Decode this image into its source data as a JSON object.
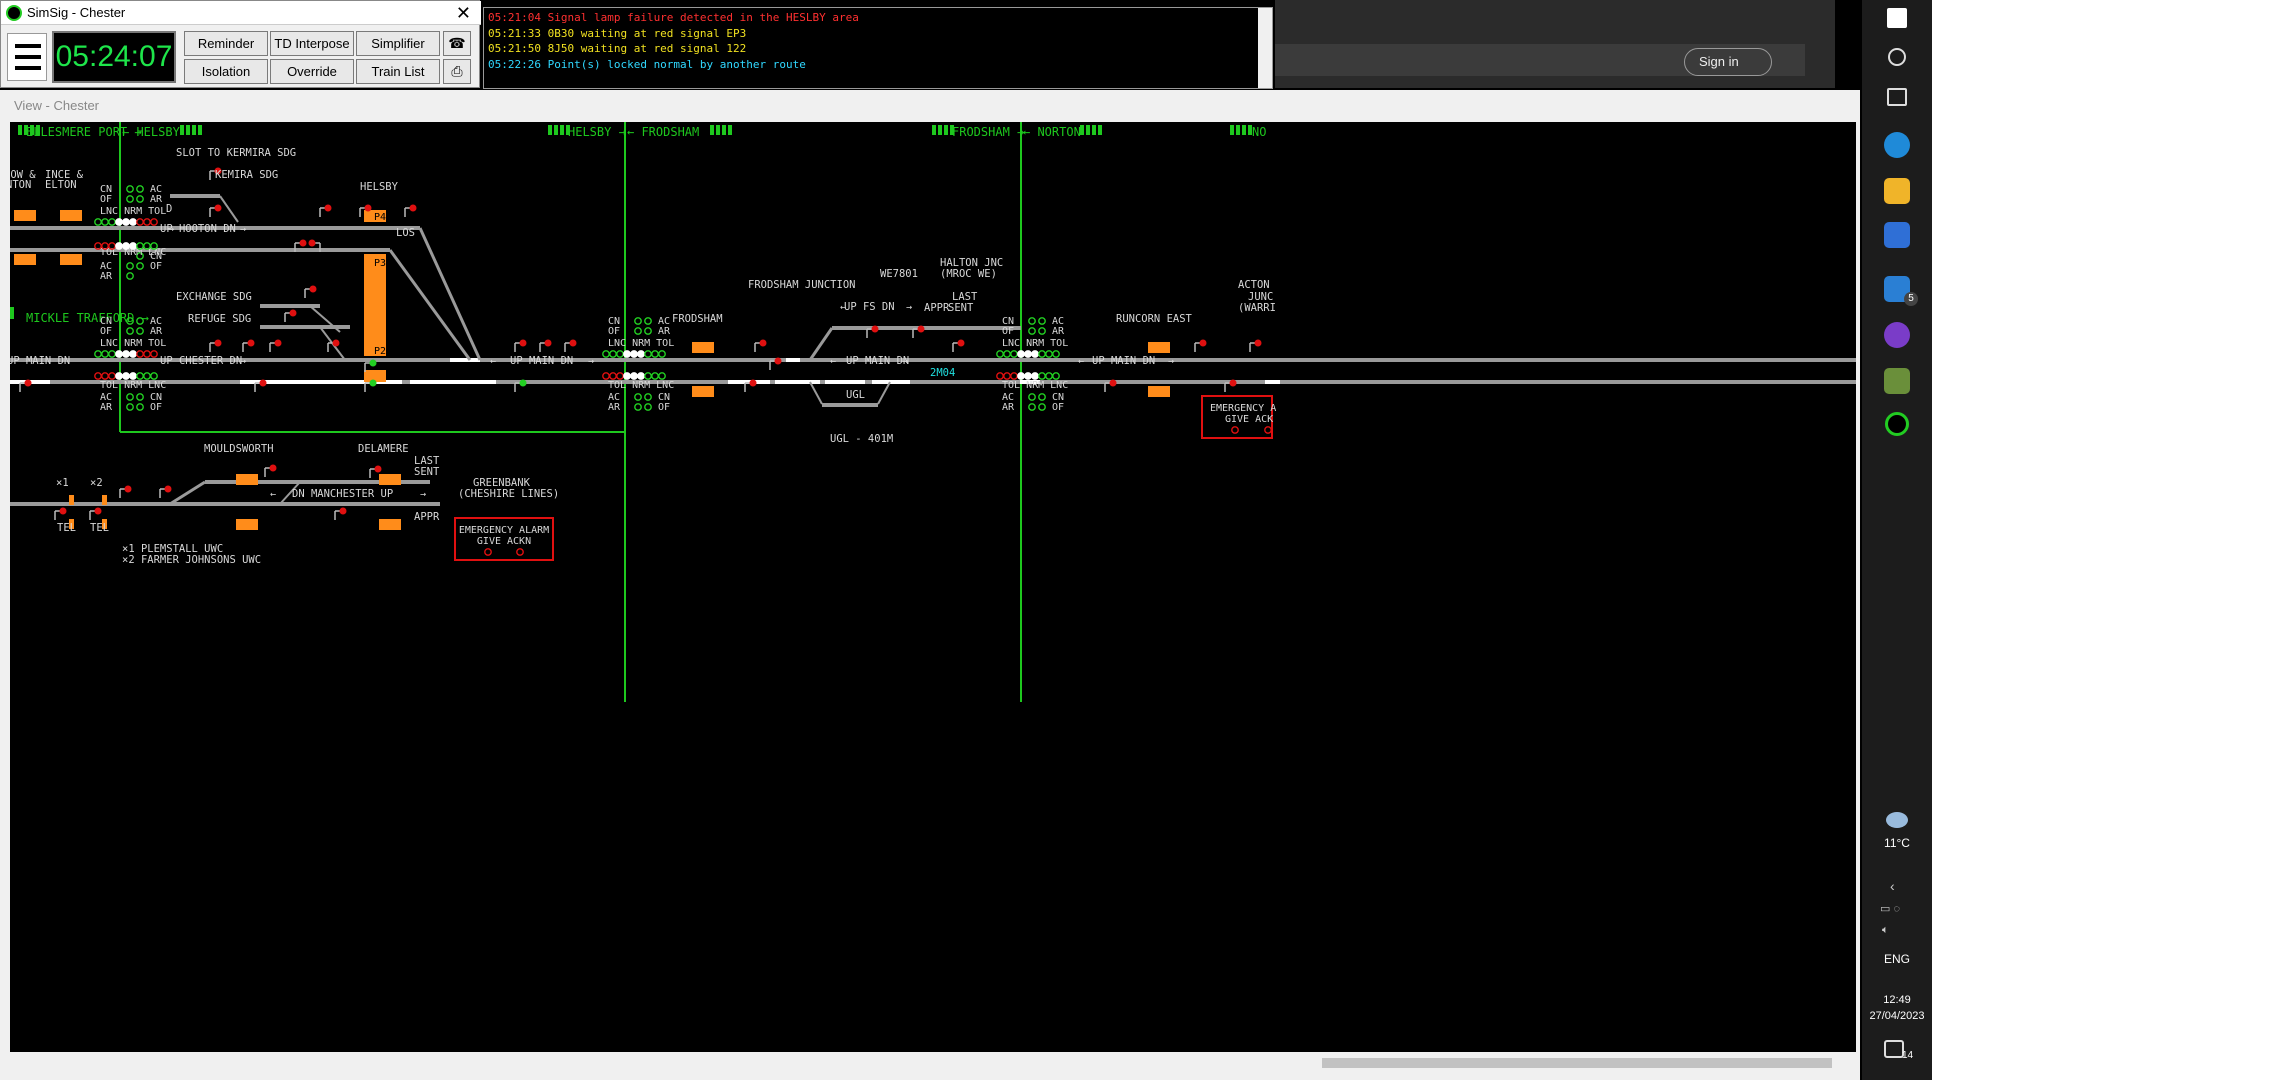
{
  "control": {
    "title": "SimSig - Chester",
    "clock": "05:24:07",
    "buttons": [
      "Reminder",
      "TD Interpose",
      "Simplifier",
      "Isolation",
      "Override",
      "Train List"
    ]
  },
  "messages": [
    {
      "text": "05:21:04 Signal lamp failure detected in the HESLBY area",
      "color": "#ff3030"
    },
    {
      "text": "05:21:33 0B30 waiting at red signal EP3",
      "color": "#f0e020"
    },
    {
      "text": "05:21:50 8J50 waiting at red signal 122",
      "color": "#f0e020"
    },
    {
      "text": "05:22:26 Point(s) locked normal by another route",
      "color": "#30d8ff"
    }
  ],
  "browser": {
    "signin": "Sign in"
  },
  "view": {
    "title": "View - Chester"
  },
  "colors": {
    "track": "#9a9a9a",
    "route": "#ffffff",
    "area": "#1ec81e",
    "label": "#d8d8d8",
    "platform": "#ff8c1a",
    "alarm": "#e01010",
    "berth": "#20e0e0"
  },
  "diagram": {
    "area_headers": [
      {
        "text": "ELLESMERE PORT →"
      },
      {
        "text": "← HELSBY"
      },
      {
        "text": "HELSBY →"
      },
      {
        "text": "← FRODSHAM"
      },
      {
        "text": "FRODSHAM →"
      },
      {
        "text": "← NORTON"
      },
      {
        "text": "NO"
      },
      {
        "text": "MICKLE TRAFFORD →"
      }
    ],
    "labels": {
      "slot": "SLOT TO KERMIRA SDG",
      "kemira": "KEMIRA SDG",
      "helsby": "HELSBY",
      "low_a": "LOW &",
      "nton": "NTON",
      "ince_a": "INCE &",
      "elton": "ELTON",
      "up_hooton": "UP HOOTON DN",
      "exchange": "EXCHANGE SDG",
      "refuge": "REFUGE SDG",
      "up_chester": "UP CHESTER DN",
      "up_main_dn_1": "UP MAIN DN",
      "up_main_dn_2": "UP MAIN DN",
      "up_main_dn_3": "UP MAIN DN",
      "up_main_dn_4": "UP MAIN DN",
      "frodsham": "FRODSHAM",
      "frod_jn": "FRODSHAM JUNCTION",
      "we7801": "WE7801",
      "halton_1": "HALTON JNC",
      "halton_2": "(MROC WE)",
      "last_sent_1": "LAST",
      "last_sent_2": "SENT",
      "up_fs_dn": "UP FS DN",
      "appr": "APPR",
      "ugl": "UGL",
      "ugl_401": "UGL - 401M",
      "runcorn": "RUNCORN EAST",
      "acton_1": "ACTON",
      "acton_2": "JUNC",
      "acton_3": "(WARRI",
      "mouldsworth": "MOULDSWORTH",
      "delamere": "DELAMERE",
      "last2_1": "LAST",
      "last2_2": "SENT",
      "appr2": "APPR",
      "dn_manchester": "DN MANCHESTER UP",
      "greenbank_1": "GREENBANK",
      "greenbank_2": "(CHESHIRE LINES)",
      "x1": "×1",
      "x2": "×2",
      "tel1": "TEL",
      "tel2": "TEL",
      "r": "R",
      "foot1": "×1 PLEMSTALL UWC",
      "foot2": "×2 FARMER JOHNSONS UWC",
      "los": "LOS",
      "berth": "2M04",
      "d": "D"
    },
    "platforms": {
      "p4": "P4",
      "p3": "P3",
      "p2": "P2",
      "p1": "P1"
    },
    "alarm": {
      "line1": "EMERGENCY ALARM",
      "line2": "GIVE ACKN",
      "line1b": "EMERGENCY A",
      "line2b": "GIVE ACK"
    },
    "control_codes": {
      "cn": "CN",
      "of": "OF",
      "ac": "AC",
      "ar": "AR",
      "lnc": "LNC",
      "nrm": "NRM",
      "tol": "TOL"
    }
  },
  "taskbar": {
    "temp": "11°C",
    "lang": "ENG",
    "time": "12:49",
    "date": "27/04/2023",
    "mail_badge": "5",
    "notif_badge": "14"
  }
}
